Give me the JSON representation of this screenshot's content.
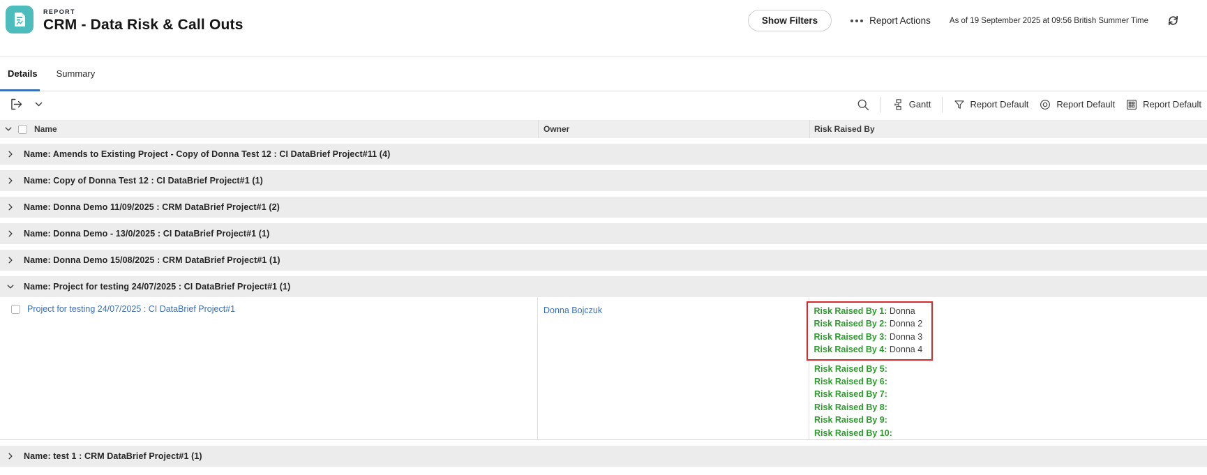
{
  "header": {
    "report_label": "REPORT",
    "title": "CRM - Data Risk & Call Outs",
    "show_filters": "Show Filters",
    "report_actions": "Report Actions",
    "as_of": "As of 19 September 2025 at 09:56 British Summer Time"
  },
  "tabs": [
    {
      "label": "Details",
      "active": true
    },
    {
      "label": "Summary",
      "active": false
    }
  ],
  "toolbar": {
    "gantt": "Gantt",
    "filter_default": "Report Default",
    "view_default": "Report Default",
    "grouping_default": "Report Default"
  },
  "table": {
    "columns": [
      "Name",
      "Owner",
      "Risk Raised By"
    ],
    "groups": [
      {
        "label": "Name: Amends to Existing Project - Copy of Donna Test 12 : CI DataBrief Project#11 (4)",
        "expanded": false
      },
      {
        "label": "Name: Copy of Donna Test 12 : CI DataBrief Project#1 (1)",
        "expanded": false
      },
      {
        "label": "Name: Donna Demo 11/09/2025 : CRM DataBrief Project#1 (2)",
        "expanded": false
      },
      {
        "label": "Name: Donna Demo - 13/0/2025 : CI DataBrief Project#1 (1)",
        "expanded": false
      },
      {
        "label": "Name: Donna Demo 15/08/2025 : CRM DataBrief Project#1 (1)",
        "expanded": false
      },
      {
        "label": "Name: Project for testing 24/07/2025 : CI DataBrief Project#1 (1)",
        "expanded": true,
        "rows": [
          {
            "name": "Project for testing 24/07/2025 : CI DataBrief Project#1",
            "owner": "Donna Bojczuk",
            "risks": [
              {
                "label": "Risk Raised By 1:",
                "value": "Donna",
                "boxed": true
              },
              {
                "label": "Risk Raised By 2:",
                "value": "Donna 2",
                "boxed": true
              },
              {
                "label": "Risk Raised By 3:",
                "value": "Donna 3",
                "boxed": true
              },
              {
                "label": "Risk Raised By 4:",
                "value": "Donna 4",
                "boxed": true
              },
              {
                "label": "Risk Raised By 5:",
                "value": "",
                "boxed": false
              },
              {
                "label": "Risk Raised By 6:",
                "value": "",
                "boxed": false
              },
              {
                "label": "Risk Raised By 7:",
                "value": "",
                "boxed": false
              },
              {
                "label": "Risk Raised By 8:",
                "value": "",
                "boxed": false
              },
              {
                "label": "Risk Raised By 9:",
                "value": "",
                "boxed": false
              },
              {
                "label": "Risk Raised By 10:",
                "value": "",
                "boxed": false
              }
            ]
          }
        ]
      },
      {
        "label": "Name: test 1 : CRM DataBrief Project#1 (1)",
        "expanded": false
      }
    ]
  },
  "icons": {
    "report": "report-document-icon",
    "refresh": "refresh-icon",
    "more": "more-dots-icon",
    "export": "export-icon",
    "search": "search-icon",
    "gantt": "hierarchy-icon",
    "filter": "funnel-icon",
    "view": "view-circle-icon",
    "grouping": "grid-icon"
  },
  "colors": {
    "accent_teal": "#4CBCBC",
    "link_blue": "#3D6EB5",
    "tab_underline_blue": "#3A70B8",
    "risk_label_green": "#2E9B2E",
    "annotation_red": "#D62B2B",
    "group_band_gray": "#ECECEC",
    "header_band_gray": "#EFEFEF"
  }
}
